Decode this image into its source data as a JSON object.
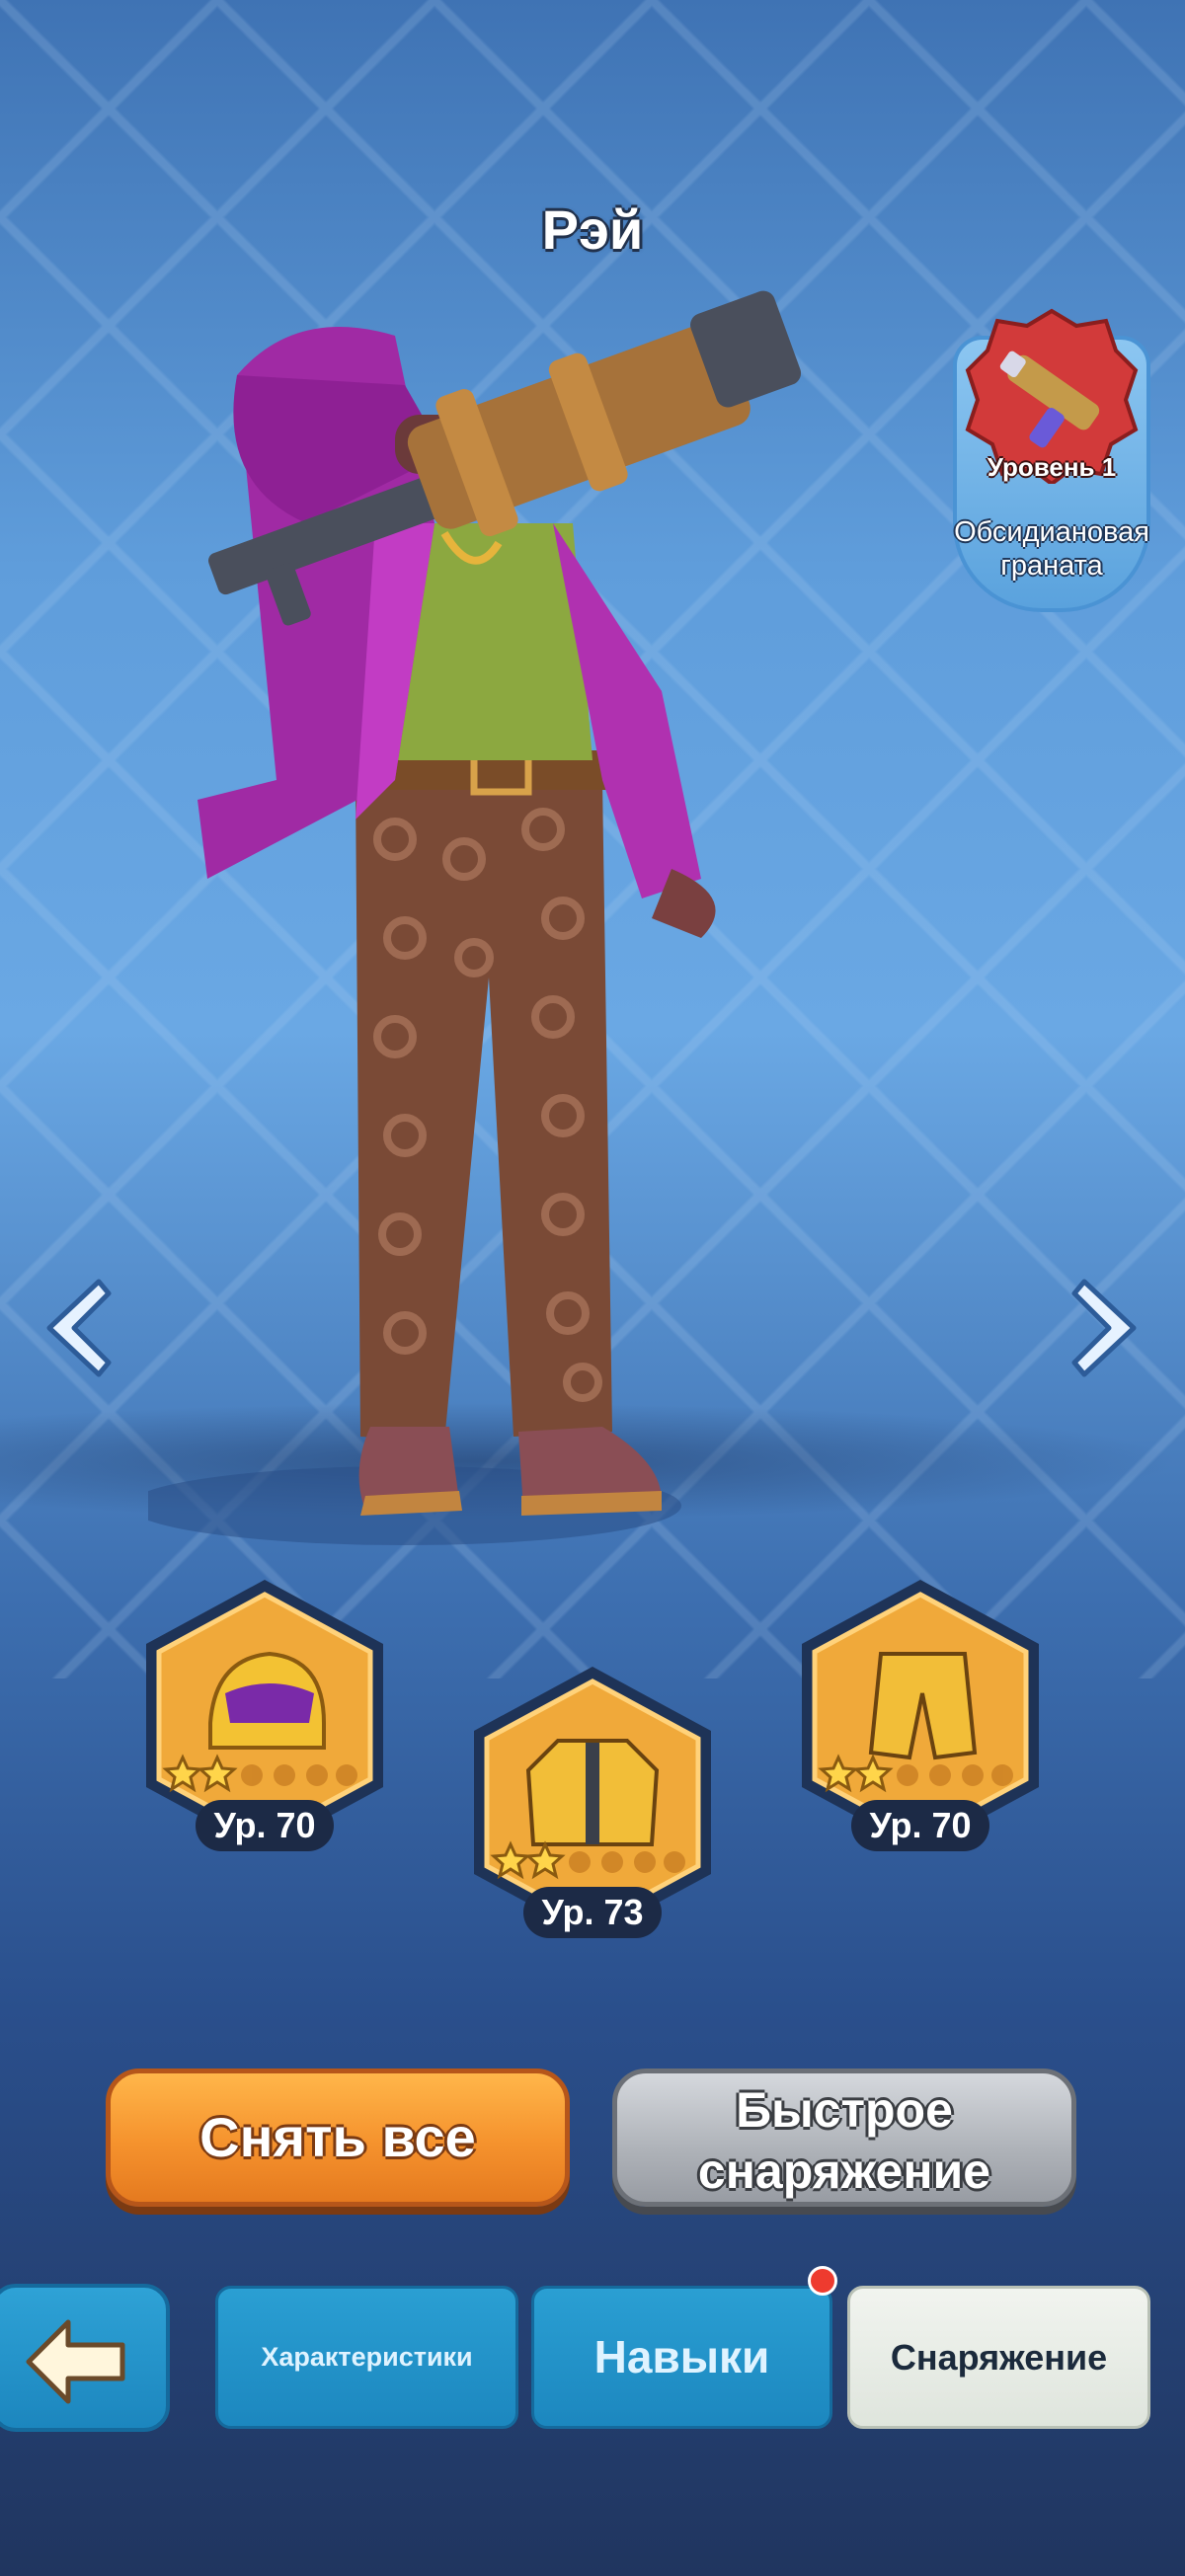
{
  "hero": {
    "name": "Рэй"
  },
  "weapon": {
    "level_label": "Уровень 1",
    "name": "Обсидиановая граната"
  },
  "gear": [
    {
      "slot": "helmet",
      "level_label": "Ур. 70",
      "stars": 2,
      "max_stars": 6
    },
    {
      "slot": "jacket",
      "level_label": "Ур. 73",
      "stars": 2,
      "max_stars": 6
    },
    {
      "slot": "pants",
      "level_label": "Ур. 70",
      "stars": 2,
      "max_stars": 6
    }
  ],
  "actions": {
    "unequip_all": "Снять все",
    "quick_equip": "Быстрое\nснаряжение"
  },
  "tabs": [
    {
      "label": "Характеристики",
      "active": false
    },
    {
      "label": "Навыки",
      "active": false,
      "notification": true
    },
    {
      "label": "Снаряжение",
      "active": true
    }
  ],
  "colors": {
    "primary_button": "#f5922d",
    "secondary_button": "#aeb2b8",
    "tab": "#1c87bf",
    "active_tab": "#e8ece6",
    "notification": "#ee3b2f"
  }
}
